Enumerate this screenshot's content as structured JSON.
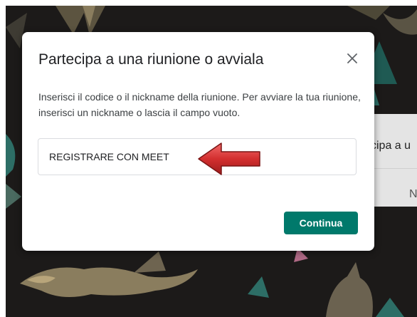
{
  "dialog": {
    "title": "Partecipa a una riunione o avviala",
    "description": "Inserisci il codice o il nickname della riunione. Per avviare la tua riunione, inserisci un nickname o lascia il campo vuoto.",
    "code_value": "REGISTRARE CON MEET",
    "continue_label": "Continua",
    "close_icon": "close-icon"
  },
  "background_card": {
    "title_fragment": "cipa a u",
    "input_fragment": "Ni"
  },
  "colors": {
    "accent": "#00796b",
    "backdrop": "#1c1a19",
    "arrow": "#d32f2f"
  }
}
